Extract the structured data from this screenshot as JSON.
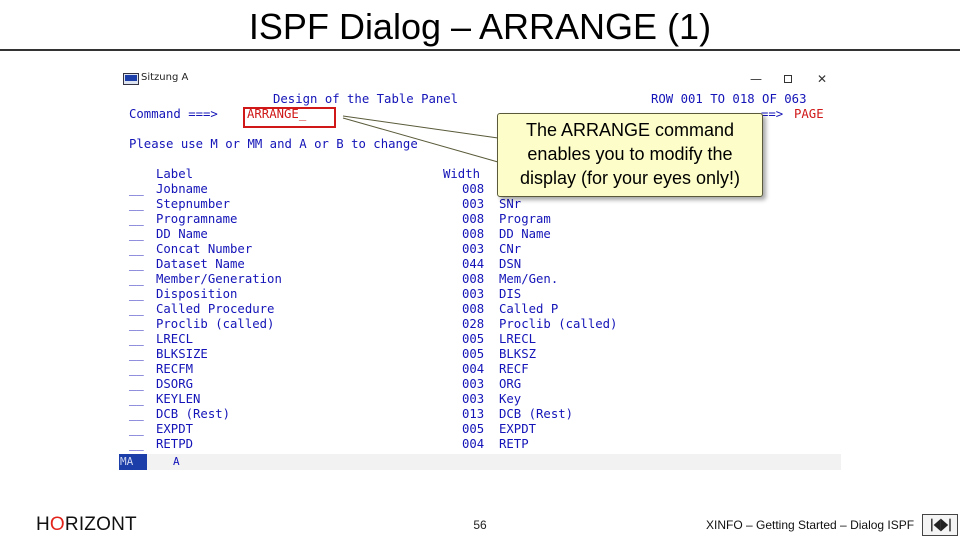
{
  "slide": {
    "title": "ISPF Dialog – ARRANGE (1)",
    "footer_logo_h": "H",
    "footer_logo_o": "O",
    "footer_logo_rest": "RIZONT",
    "page_number": "56",
    "footer_right": "XINFO – Getting Started – Dialog ISPF"
  },
  "window": {
    "title": "Sitzung A",
    "buttons": {
      "minimize": "—",
      "close": "✕"
    }
  },
  "panel": {
    "heading": "Design of the Table Panel",
    "row_info": "ROW 001 TO 018 OF 063",
    "command_prompt": "Command ===>",
    "command_value": "ARRANGE_",
    "scroll_prompt": "==>",
    "scroll_value": "PAGE",
    "instruction": "Please use M or MM and A or B to change",
    "col_label": "Label",
    "col_width": "Width",
    "rows": [
      {
        "sel": "__",
        "label": "Jobname",
        "width": "008",
        "short": ""
      },
      {
        "sel": "__",
        "label": "Stepnumber",
        "width": "003",
        "short": "SNr"
      },
      {
        "sel": "__",
        "label": "Programname",
        "width": "008",
        "short": "Program"
      },
      {
        "sel": "__",
        "label": "DD Name",
        "width": "008",
        "short": "DD Name"
      },
      {
        "sel": "__",
        "label": "Concat Number",
        "width": "003",
        "short": "CNr"
      },
      {
        "sel": "__",
        "label": "Dataset Name",
        "width": "044",
        "short": "DSN"
      },
      {
        "sel": "__",
        "label": "Member/Generation",
        "width": "008",
        "short": "Mem/Gen."
      },
      {
        "sel": "__",
        "label": "Disposition",
        "width": "003",
        "short": "DIS"
      },
      {
        "sel": "__",
        "label": "Called Procedure",
        "width": "008",
        "short": "Called P"
      },
      {
        "sel": "__",
        "label": "Proclib (called)",
        "width": "028",
        "short": "Proclib (called)"
      },
      {
        "sel": "__",
        "label": "LRECL",
        "width": "005",
        "short": "LRECL"
      },
      {
        "sel": "__",
        "label": "BLKSIZE",
        "width": "005",
        "short": "BLKSZ"
      },
      {
        "sel": "__",
        "label": "RECFM",
        "width": "004",
        "short": "RECF"
      },
      {
        "sel": "__",
        "label": "DSORG",
        "width": "003",
        "short": "ORG"
      },
      {
        "sel": "__",
        "label": "KEYLEN",
        "width": "003",
        "short": "Key"
      },
      {
        "sel": "__",
        "label": "DCB (Rest)",
        "width": "013",
        "short": "DCB (Rest)"
      },
      {
        "sel": "__",
        "label": "EXPDT",
        "width": "005",
        "short": "EXPDT"
      },
      {
        "sel": "__",
        "label": "RETPD",
        "width": "004",
        "short": "RETP"
      }
    ],
    "oia_left": "MA",
    "oia_indicator": "A"
  },
  "callout": {
    "line1": "The ARRANGE command",
    "line2": "enables you to modify the",
    "line3": "display (for your eyes only!)"
  },
  "colors": {
    "terminal_text": "#1414b8",
    "highlight": "#d01818",
    "callout_bg": "#fdfdc9",
    "logo_accent": "#e2231a"
  }
}
